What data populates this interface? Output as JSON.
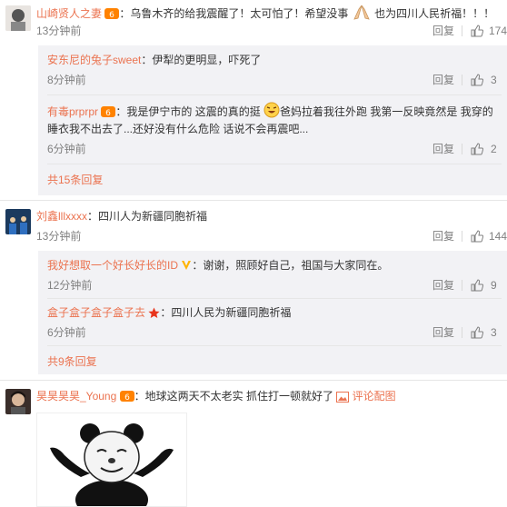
{
  "comments": [
    {
      "user": "山崎贤人之妻",
      "text_a": "：乌鲁木齐的给我震醒了！太可怕了！希望没事",
      "text_b": "也为四川人民祈福！！！",
      "time": "13分钟前",
      "reply": "回复",
      "likes": "174",
      "replies": [
        {
          "user": "安东尼的兔子sweet",
          "text": "：伊犁的更明显，吓死了",
          "time": "8分钟前",
          "reply": "回复",
          "likes": "3"
        },
        {
          "user": "有毒prprpr",
          "text_a": "：我是伊宁市的 这震的真的挺",
          "text_b": "爸妈拉着我往外跑 我第一反映竟然是 我穿的",
          "text_c": "睡衣我不出去了...还好没有什么危险 话说不会再震吧...",
          "time": "6分钟前",
          "reply": "回复",
          "likes": "2"
        }
      ],
      "more": "共15条回复"
    },
    {
      "user": "刘鑫lllxxxx",
      "text": "：四川人为新疆同胞祈福",
      "time": "13分钟前",
      "reply": "回复",
      "likes": "144",
      "replies": [
        {
          "user": "我好想取一个好长好长的ID",
          "text": "：谢谢，照顾好自己，祖国与大家同在。",
          "time": "12分钟前",
          "reply": "回复",
          "likes": "9"
        },
        {
          "user": "盒子盒子盒子盒子去",
          "text": "：四川人民为新疆同胞祈福",
          "time": "6分钟前",
          "reply": "回复",
          "likes": "3"
        }
      ],
      "more": "共9条回复"
    },
    {
      "user": "昊昊昊昊_Young",
      "text": "：地球这两天不太老实 抓住打一顿就好了",
      "pic_link": "评论配图"
    }
  ],
  "colors": {
    "accent": "#eb7350",
    "muted": "#808080",
    "subbg": "#f2f2f5"
  },
  "icons": [
    "thumb-up-icon",
    "vip-badge-icon",
    "prayer-hands-emoji",
    "laugh-cry-emoji",
    "star-badge-icon",
    "picture-icon"
  ]
}
